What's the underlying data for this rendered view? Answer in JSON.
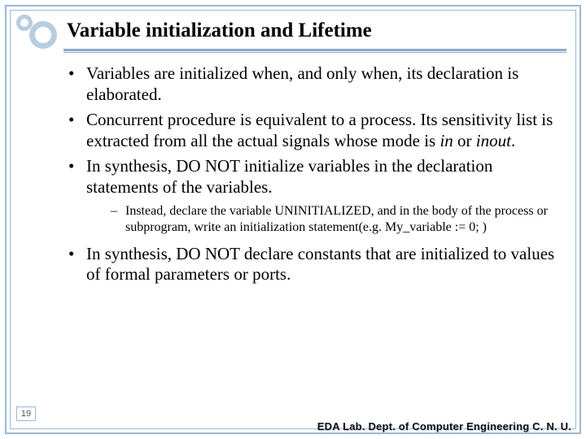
{
  "title": "Variable initialization and Lifetime",
  "bullets": {
    "b1": "Variables are initialized when, and only when, its declaration is elaborated.",
    "b2_a": "Concurrent procedure is equivalent to a process. Its sensitivity list is extracted from all the actual signals whose mode is ",
    "b2_in": "in",
    "b2_or": " or ",
    "b2_inout": "inout",
    "b2_end": ".",
    "b3": "In synthesis, DO NOT initialize variables in the declaration statements of the variables.",
    "sub1": "Instead, declare the variable UNINITIALIZED, and in the body of the process or subprogram, write an initialization statement(e.g. My_variable := 0; )",
    "b4": "In synthesis, DO NOT declare constants that are initialized to values of formal parameters or ports."
  },
  "page_number": "19",
  "footer": "EDA Lab. Dept. of Computer Engineering C. N. U."
}
